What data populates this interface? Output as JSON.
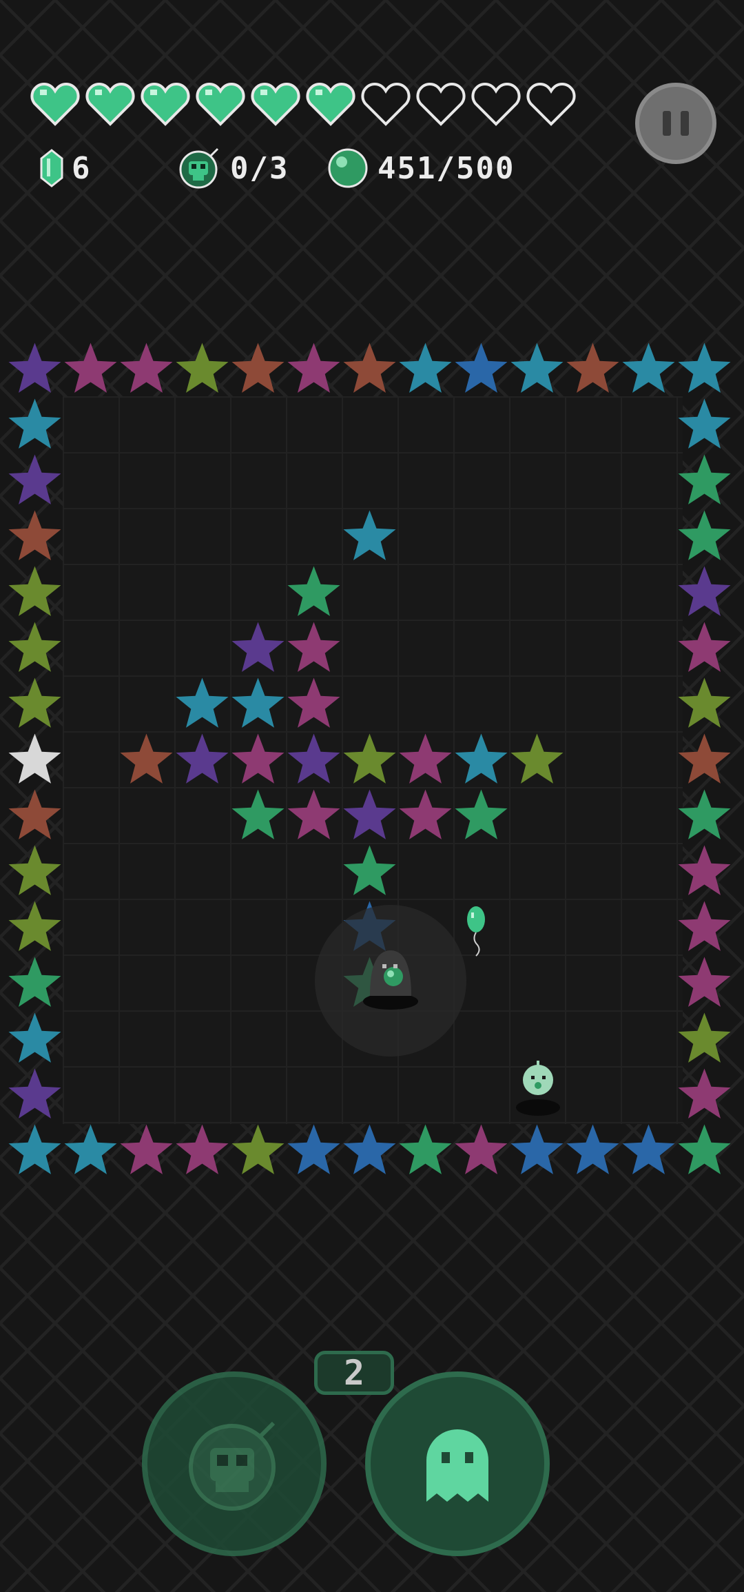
{
  "hud": {
    "hearts": {
      "filled": 6,
      "total": 10
    },
    "gems": {
      "icon": "gem-icon",
      "value": "6"
    },
    "skulls": {
      "icon": "skull-bomb-icon",
      "value": "0/3"
    },
    "orbs": {
      "icon": "orb-icon",
      "value": "451/500"
    },
    "pause": {
      "icon": "pause-icon"
    }
  },
  "colors": {
    "green": "#2f9a62",
    "teal": "#2a8aa4",
    "blue": "#2a67a8",
    "purple": "#5a3a8e",
    "magenta": "#8e3a72",
    "olive": "#6a8a2e",
    "rust": "#8e4a38",
    "white": "#d8d8d8",
    "bright": "#3cc07a",
    "heart": "#3ec487"
  },
  "board": {
    "cols": 13,
    "rows": 15,
    "stars": [
      [
        0,
        0,
        "purple"
      ],
      [
        1,
        0,
        "magenta"
      ],
      [
        2,
        0,
        "magenta"
      ],
      [
        3,
        0,
        "olive"
      ],
      [
        4,
        0,
        "rust"
      ],
      [
        5,
        0,
        "magenta"
      ],
      [
        6,
        0,
        "rust"
      ],
      [
        7,
        0,
        "teal"
      ],
      [
        8,
        0,
        "blue"
      ],
      [
        9,
        0,
        "teal"
      ],
      [
        10,
        0,
        "rust"
      ],
      [
        11,
        0,
        "teal"
      ],
      [
        12,
        0,
        "teal"
      ],
      [
        0,
        1,
        "teal"
      ],
      [
        12,
        1,
        "teal"
      ],
      [
        0,
        2,
        "purple"
      ],
      [
        12,
        2,
        "green"
      ],
      [
        0,
        3,
        "rust"
      ],
      [
        6,
        3,
        "teal"
      ],
      [
        12,
        3,
        "green"
      ],
      [
        0,
        4,
        "olive"
      ],
      [
        5,
        4,
        "green"
      ],
      [
        12,
        4,
        "purple"
      ],
      [
        0,
        5,
        "olive"
      ],
      [
        4,
        5,
        "purple"
      ],
      [
        5,
        5,
        "magenta"
      ],
      [
        12,
        5,
        "magenta"
      ],
      [
        0,
        6,
        "olive"
      ],
      [
        3,
        6,
        "teal"
      ],
      [
        4,
        6,
        "teal"
      ],
      [
        5,
        6,
        "magenta"
      ],
      [
        12,
        6,
        "olive"
      ],
      [
        0,
        7,
        "white"
      ],
      [
        2,
        7,
        "rust"
      ],
      [
        3,
        7,
        "purple"
      ],
      [
        4,
        7,
        "magenta"
      ],
      [
        5,
        7,
        "purple"
      ],
      [
        6,
        7,
        "olive"
      ],
      [
        7,
        7,
        "magenta"
      ],
      [
        8,
        7,
        "teal"
      ],
      [
        9,
        7,
        "olive"
      ],
      [
        12,
        7,
        "rust"
      ],
      [
        0,
        8,
        "rust"
      ],
      [
        4,
        8,
        "green"
      ],
      [
        5,
        8,
        "magenta"
      ],
      [
        6,
        8,
        "purple"
      ],
      [
        7,
        8,
        "magenta"
      ],
      [
        8,
        8,
        "green"
      ],
      [
        12,
        8,
        "green"
      ],
      [
        0,
        9,
        "olive"
      ],
      [
        6,
        9,
        "green"
      ],
      [
        12,
        9,
        "magenta"
      ],
      [
        0,
        10,
        "olive"
      ],
      [
        6,
        10,
        "blue"
      ],
      [
        12,
        10,
        "magenta"
      ],
      [
        0,
        11,
        "green"
      ],
      [
        6,
        11,
        "bright"
      ],
      [
        12,
        11,
        "magenta"
      ],
      [
        0,
        12,
        "teal"
      ],
      [
        12,
        12,
        "olive"
      ],
      [
        0,
        13,
        "purple"
      ],
      [
        12,
        13,
        "magenta"
      ],
      [
        0,
        14,
        "teal"
      ],
      [
        1,
        14,
        "teal"
      ],
      [
        2,
        14,
        "magenta"
      ],
      [
        3,
        14,
        "magenta"
      ],
      [
        4,
        14,
        "olive"
      ],
      [
        5,
        14,
        "blue"
      ],
      [
        6,
        14,
        "blue"
      ],
      [
        7,
        14,
        "green"
      ],
      [
        8,
        14,
        "magenta"
      ],
      [
        9,
        14,
        "blue"
      ],
      [
        10,
        14,
        "blue"
      ],
      [
        11,
        14,
        "blue"
      ],
      [
        12,
        14,
        "green"
      ]
    ],
    "player": {
      "icon": "hooded-player-icon",
      "col": 7,
      "row": 11
    },
    "balloon": {
      "icon": "balloon-icon",
      "col": 8,
      "row": 10
    },
    "enemy": {
      "icon": "round-creature-icon",
      "col": 9,
      "row": 13
    }
  },
  "actions": {
    "count": "2",
    "skull_button": {
      "icon": "skull-bomb-icon"
    },
    "ghost_button": {
      "icon": "ghost-icon"
    }
  }
}
